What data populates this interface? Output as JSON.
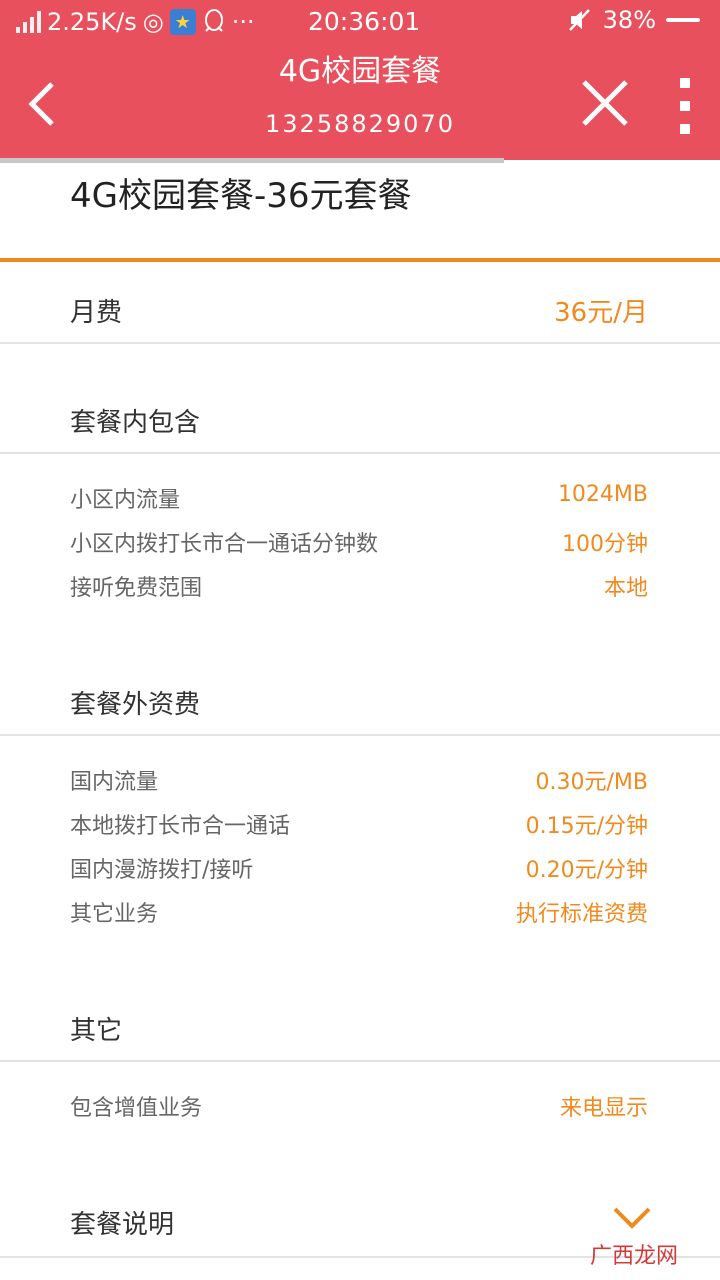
{
  "status_bar": {
    "speed": "2.25K/s",
    "time": "20:36:01",
    "battery": "38%",
    "icons": [
      "signal-icon",
      "target-icon",
      "star-app-icon",
      "qq-icon",
      "more-dots-icon",
      "mute-icon",
      "battery-icon"
    ]
  },
  "header": {
    "title": "4G校园套餐",
    "phone": "13258829070",
    "back_icon": "chevron-left-icon",
    "close_icon": "close-icon",
    "menu_icon": "more-vertical-icon",
    "bg_color": "#e8505e",
    "load_progress": 0.7
  },
  "plan": {
    "name": "4G校园套餐-36元套餐",
    "accent_color": "#f08a1e"
  },
  "monthly_fee": {
    "label": "月费",
    "value": "36元/月"
  },
  "included": {
    "title": "套餐内包含",
    "items": [
      {
        "label": "小区内流量",
        "value": "1024MB"
      },
      {
        "label": "小区内拨打长市合一通话分钟数",
        "value": "100分钟"
      },
      {
        "label": "接听免费范围",
        "value": "本地"
      }
    ]
  },
  "extra_fees": {
    "title": "套餐外资费",
    "items": [
      {
        "label": "国内流量",
        "value": "0.30元/MB"
      },
      {
        "label": "本地拨打长市合一通话",
        "value": "0.15元/分钟"
      },
      {
        "label": "国内漫游拨打/接听",
        "value": "0.20元/分钟"
      },
      {
        "label": "其它业务",
        "value": "执行标准资费"
      }
    ]
  },
  "other": {
    "title": "其它",
    "items": [
      {
        "label": "包含增值业务",
        "value": "来电显示"
      }
    ]
  },
  "description": {
    "title": "套餐说明",
    "icon": "chevron-down-icon"
  },
  "watermark": "广西龙网"
}
